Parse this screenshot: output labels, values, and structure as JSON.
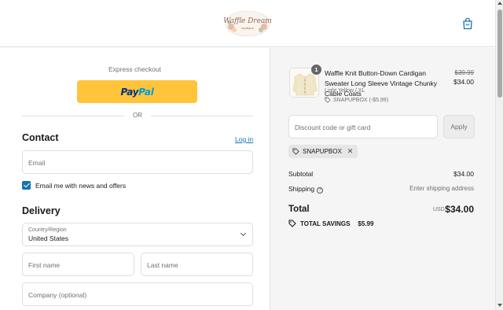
{
  "header": {
    "logo_text": "Waffle Dream",
    "logo_subtext": "boutique"
  },
  "express": {
    "label": "Express checkout",
    "paypal_a": "Pay",
    "paypal_b": "Pal",
    "or": "OR"
  },
  "contact": {
    "title": "Contact",
    "login": "Log in",
    "email_placeholder": "Email",
    "newsletter_label": "Email me with news and offers",
    "newsletter_checked": true
  },
  "delivery": {
    "title": "Delivery",
    "country_label": "Country/Region",
    "country_value": "United States",
    "first_name_placeholder": "First name",
    "last_name_placeholder": "Last name",
    "company_placeholder": "Company (optional)"
  },
  "order": {
    "item": {
      "quantity": "1",
      "name": "Waffle Knit Button-Down Cardigan Sweater Long Sleeve Vintage Chunky Cable Coats",
      "variant": "Light Yellow / XL",
      "discount": "SNAPUPBOX (-$5.99)",
      "price_original": "$39.99",
      "price_final": "$34.00"
    },
    "discount_placeholder": "Discount code or gift card",
    "apply_label": "Apply",
    "applied_code": "SNAPUPBOX",
    "subtotal_label": "Subtotal",
    "subtotal_value": "$34.00",
    "shipping_label": "Shipping",
    "shipping_value": "Enter shipping address",
    "total_label": "Total",
    "total_currency": "USD",
    "total_value": "$34.00",
    "savings_label": "TOTAL SAVINGS",
    "savings_value": "$5.99"
  },
  "colors": {
    "accent": "#1773b0",
    "paypal_yellow": "#ffc439",
    "summary_bg": "#f5f5f5"
  }
}
